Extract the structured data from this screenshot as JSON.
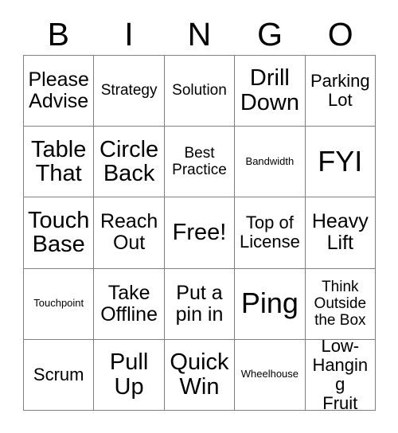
{
  "card": {
    "title": "BINGO",
    "header_letters": [
      "B",
      "I",
      "N",
      "G",
      "O"
    ],
    "free_space_label": "Free!",
    "grid_line_color": "#808080",
    "text_color": "#000000",
    "background_color": "#ffffff"
  },
  "grid": {
    "rows": [
      {
        "cells": [
          {
            "label": "Please\nAdvise",
            "size": "fs-xl"
          },
          {
            "label": "Strategy",
            "size": "fs-md"
          },
          {
            "label": "Solution",
            "size": "fs-md"
          },
          {
            "label": "Drill\nDown",
            "size": "fs-xxl"
          },
          {
            "label": "Parking\nLot",
            "size": "fs-lg"
          }
        ]
      },
      {
        "cells": [
          {
            "label": "Table\nThat",
            "size": "fs-xxl"
          },
          {
            "label": "Circle\nBack",
            "size": "fs-xxl"
          },
          {
            "label": "Best\nPractice",
            "size": "fs-md"
          },
          {
            "label": "Bandwidth",
            "size": "fs-xs"
          },
          {
            "label": "FYI",
            "size": "fs-huge"
          }
        ]
      },
      {
        "cells": [
          {
            "label": "Touch\nBase",
            "size": "fs-xxl"
          },
          {
            "label": "Reach\nOut",
            "size": "fs-xl"
          },
          {
            "label": "Free!",
            "size": "fs-xxl"
          },
          {
            "label": "Top of\nLicense",
            "size": "fs-lg"
          },
          {
            "label": "Heavy\nLift",
            "size": "fs-xl"
          }
        ]
      },
      {
        "cells": [
          {
            "label": "Touchpoint",
            "size": "fs-xs"
          },
          {
            "label": "Take\nOffline",
            "size": "fs-xl"
          },
          {
            "label": "Put a\npin in",
            "size": "fs-xl"
          },
          {
            "label": "Ping",
            "size": "fs-huge"
          },
          {
            "label": "Think\nOutside\nthe Box",
            "size": "fs-md"
          }
        ]
      },
      {
        "cells": [
          {
            "label": "Scrum",
            "size": "fs-lg"
          },
          {
            "label": "Pull\nUp",
            "size": "fs-xxl"
          },
          {
            "label": "Quick\nWin",
            "size": "fs-xxl"
          },
          {
            "label": "Wheelhouse",
            "size": "fs-xs"
          },
          {
            "label": "Low-\nHanging\nFruit",
            "size": "fs-lg"
          }
        ]
      }
    ]
  }
}
